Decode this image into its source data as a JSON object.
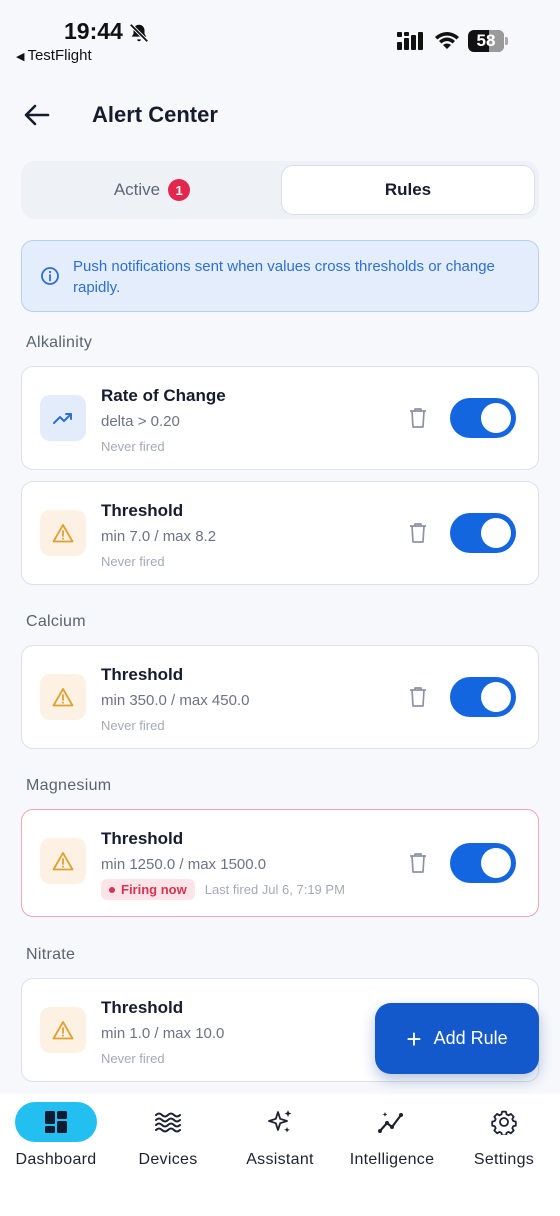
{
  "status_bar": {
    "time": "19:44",
    "back_app": "TestFlight",
    "battery": "58",
    "battery_fraction": 0.58
  },
  "header": {
    "title": "Alert Center"
  },
  "tabs": {
    "active_label": "Active",
    "active_count": "1",
    "rules_label": "Rules"
  },
  "info": {
    "text": "Push notifications sent when values cross thresholds or change rapidly."
  },
  "sections": [
    {
      "label": "Alkalinity",
      "rules": [
        {
          "title": "Rate of Change",
          "condition": "delta > 0.20",
          "fired": "Never fired",
          "icon": "trending-up-icon",
          "enabled": true
        },
        {
          "title": "Threshold",
          "condition": "min 7.0 / max 8.2",
          "fired": "Never fired",
          "icon": "warning-icon",
          "enabled": true
        }
      ]
    },
    {
      "label": "Calcium",
      "rules": [
        {
          "title": "Threshold",
          "condition": "min 350.0 / max 450.0",
          "fired": "Never fired",
          "icon": "warning-icon",
          "enabled": true
        }
      ]
    },
    {
      "label": "Magnesium",
      "rules": [
        {
          "title": "Threshold",
          "condition": "min 1250.0 / max 1500.0",
          "status": "Firing now",
          "fired": "Last fired Jul 6, 7:19 PM",
          "icon": "warning-icon",
          "enabled": true
        }
      ]
    },
    {
      "label": "Nitrate",
      "rules": [
        {
          "title": "Threshold",
          "condition": "min 1.0 / max 10.0",
          "fired": "Never fired",
          "icon": "warning-icon",
          "enabled": true
        }
      ]
    }
  ],
  "fab": {
    "label": "Add Rule"
  },
  "nav": [
    {
      "label": "Dashboard",
      "icon": "dashboard-icon",
      "active": true
    },
    {
      "label": "Devices",
      "icon": "waves-icon",
      "active": false
    },
    {
      "label": "Assistant",
      "icon": "sparkles-icon",
      "active": false
    },
    {
      "label": "Intelligence",
      "icon": "insights-icon",
      "active": false
    },
    {
      "label": "Settings",
      "icon": "gear-icon",
      "active": false
    }
  ],
  "colors": {
    "accent": "#1466e0",
    "badge": "#e2264d",
    "warning": "#e0a030",
    "firing": "#d8344f",
    "nav_active": "#22bff0"
  }
}
